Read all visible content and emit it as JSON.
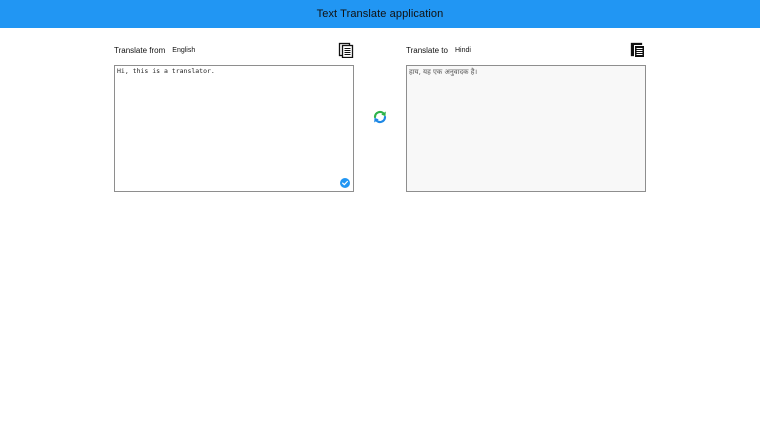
{
  "header": {
    "title": "Text Translate application"
  },
  "source": {
    "label": "Translate from",
    "language": "English",
    "text": "Hi, this is a translator."
  },
  "target": {
    "label": "Translate to",
    "language": "Hindi",
    "text": "हाय, यह एक अनुवादक है।"
  },
  "icons": {
    "copy_source": "copy-icon",
    "copy_target": "copy-icon",
    "swap": "swap-arrows-icon",
    "check": "check-circle-icon"
  },
  "colors": {
    "header_bg": "#2196f3",
    "swap_green": "#2db34a",
    "swap_blue": "#1e88e5",
    "check_blue": "#2196f3"
  }
}
